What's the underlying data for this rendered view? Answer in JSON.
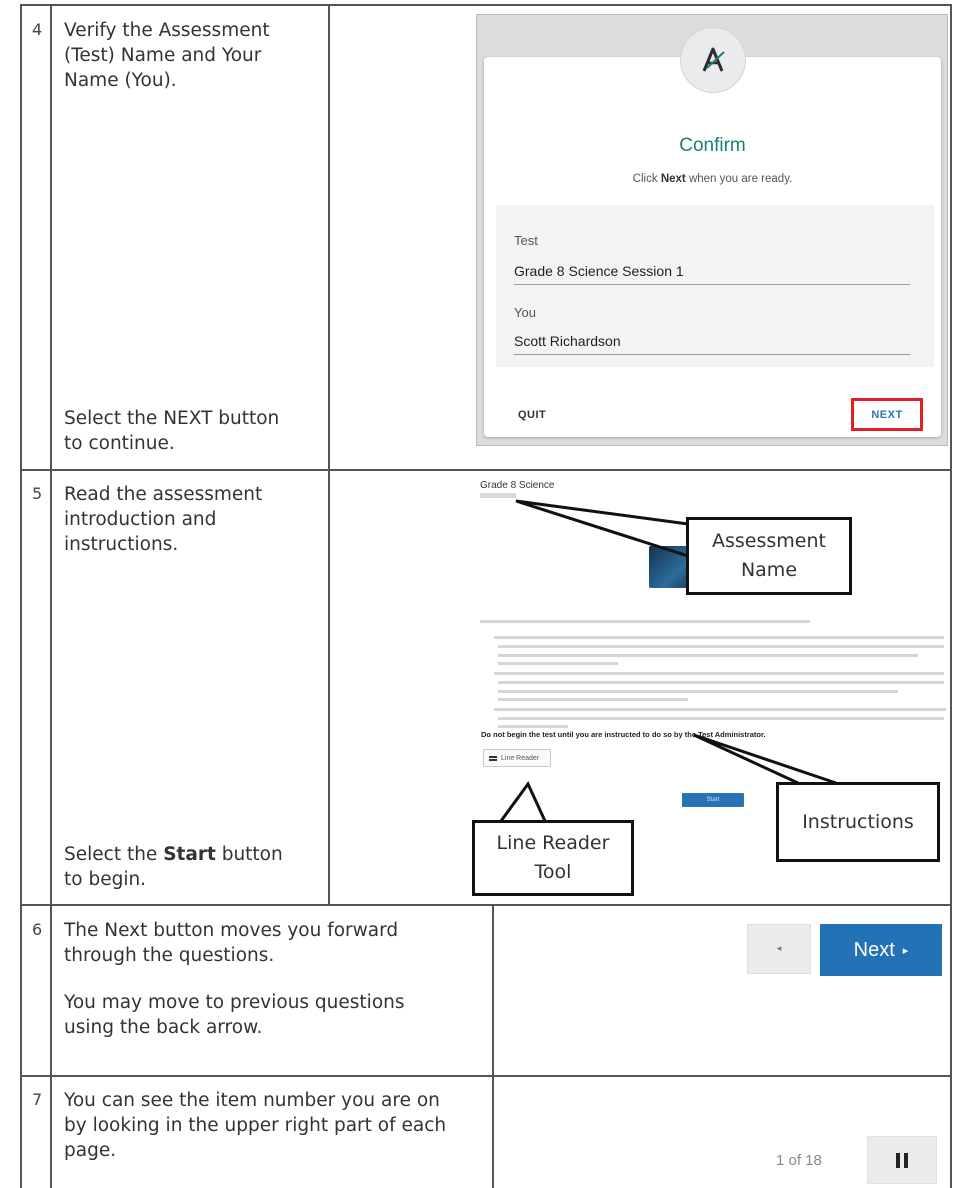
{
  "rows": [
    {
      "number": "4",
      "instruction_lines": [
        "Verify the Assessment",
        "(Test) Name and Your",
        "Name (You)."
      ],
      "action_lines": [
        "Select the NEXT button",
        "to continue."
      ]
    },
    {
      "number": "5",
      "instruction_lines": [
        "Read the assessment",
        "introduction and",
        "instructions."
      ],
      "action_prefix": "Select the ",
      "action_bold": "Start",
      "action_suffix": " button",
      "action_line2": "to begin."
    },
    {
      "number": "6",
      "line1": "The Next button moves you forward",
      "line2": "through the questions.",
      "line3": "You may move to previous questions",
      "line4": "using the back arrow."
    },
    {
      "number": "7",
      "line1": "You can see the item number you are on",
      "line2": "by looking in the upper right part of each",
      "line3": "page."
    }
  ],
  "confirm_screen": {
    "title": "Confirm",
    "subtitle_prefix": "Click ",
    "subtitle_bold": "Next",
    "subtitle_suffix": " when you are ready.",
    "test_label": "Test",
    "test_value": "Grade 8 Science Session 1",
    "you_label": "You",
    "you_value": "Scott Richardson",
    "quit_label": "QUIT",
    "next_label": "NEXT",
    "highlight_color": "#e21f26",
    "accent_color": "#1d7f71"
  },
  "intro_screen": {
    "assessment_title": "Grade 8 Science",
    "bold_line": "Do not begin the test until you are instructed to do so by the Test Administrator.",
    "line_reader_label": "Line Reader",
    "start_label": "Start",
    "callouts": {
      "assessment_name": [
        "Assessment",
        "Name"
      ],
      "instructions": [
        "Instructions"
      ],
      "line_reader_tool": [
        "Line Reader",
        "Tool"
      ]
    }
  },
  "nav_buttons": {
    "back_symbol": "◂",
    "next_label": "Next",
    "next_symbol": "▸",
    "next_color": "#2472b6"
  },
  "progress": {
    "counter_text": "1 of 18"
  }
}
